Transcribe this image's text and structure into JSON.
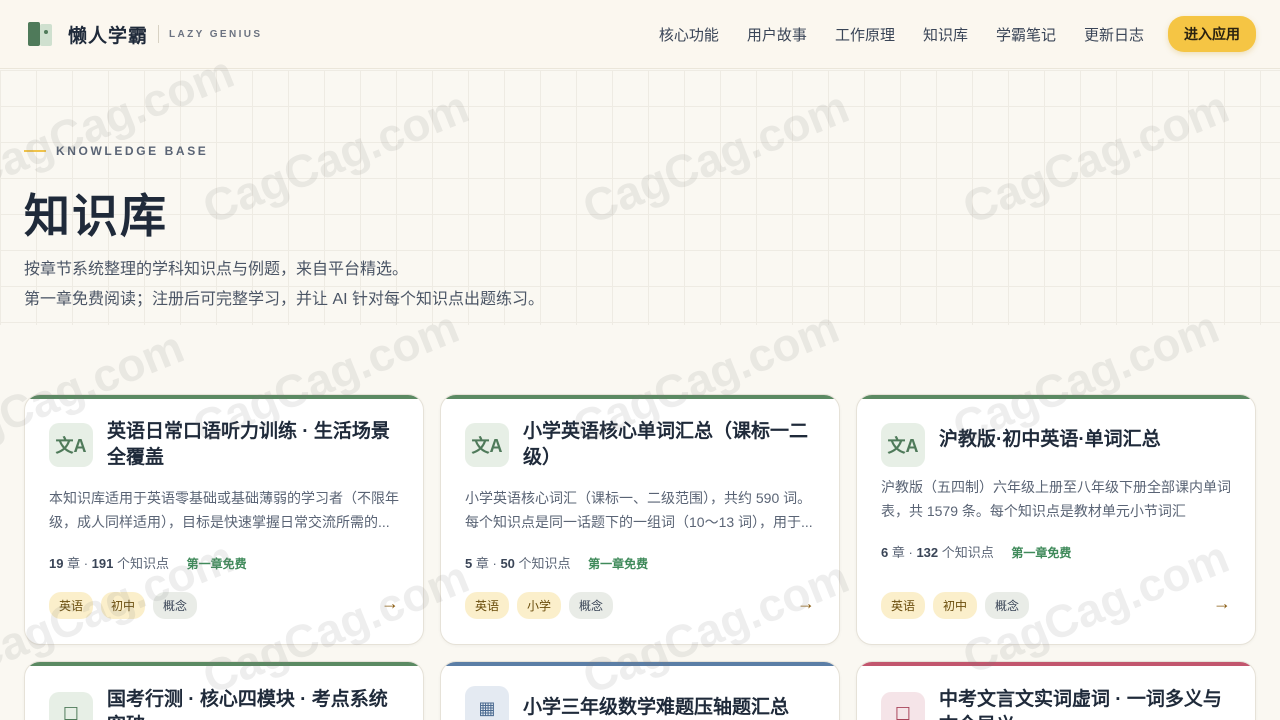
{
  "header": {
    "brand_name": "懒人学霸",
    "brand_en": "LAZY GENIUS",
    "nav": [
      "核心功能",
      "用户故事",
      "工作原理",
      "知识库",
      "学霸笔记",
      "更新日志"
    ],
    "cta_label": "进入应用"
  },
  "hero": {
    "eyebrow": "KNOWLEDGE BASE",
    "title": "知识库",
    "desc_line1": "按章节系统整理的学科知识点与例题，来自平台精选。",
    "desc_line2": "第一章免费阅读；注册后可完整学习，并让 AI 针对每个知识点出题练习。"
  },
  "cards": [
    {
      "icon": "文A",
      "title": "英语日常口语听力训练 · 生活场景全覆盖",
      "desc": "本知识库适用于英语零基础或基础薄弱的学习者（不限年级，成人同样适用），目标是快速掌握日常交流所需的...",
      "chapters": "19",
      "chapter_unit": "章 ·",
      "points": "191",
      "points_unit": "个知识点",
      "free": "第一章免费",
      "tags": [
        "英语",
        "初中",
        "概念"
      ],
      "accent": "#5b8a63"
    },
    {
      "icon": "文A",
      "title": "小学英语核心单词汇总（课标一二级）",
      "desc": "小学英语核心词汇（课标一、二级范围），共约 590 词。每个知识点是同一话题下的一组词（10～13 词），用于...",
      "chapters": "5",
      "chapter_unit": "章 ·",
      "points": "50",
      "points_unit": "个知识点",
      "free": "第一章免费",
      "tags": [
        "英语",
        "小学",
        "概念"
      ],
      "accent": "#5b8a63"
    },
    {
      "icon": "文A",
      "title": "沪教版·初中英语·单词汇总",
      "desc": "沪教版（五四制）六年级上册至八年级下册全部课内单词表，共 1579 条。每个知识点是教材单元小节词汇表），...",
      "chapters": "6",
      "chapter_unit": "章 ·",
      "points": "132",
      "points_unit": "个知识点",
      "free": "第一章免费",
      "tags": [
        "英语",
        "初中",
        "概念"
      ],
      "accent": "#5b8a63"
    },
    {
      "icon": "☐",
      "title": "国考行测 · 核心四模块 · 考点系统突破",
      "accent": "#5b8a63"
    },
    {
      "icon": "▦",
      "title": "小学三年级数学难题压轴题汇总",
      "accent": "#5b7ea6"
    },
    {
      "icon": "☐",
      "title": "中考文言文实词虚词 · 一词多义与古今异义",
      "accent": "#c2566e"
    }
  ],
  "watermark": "CagCag.com"
}
